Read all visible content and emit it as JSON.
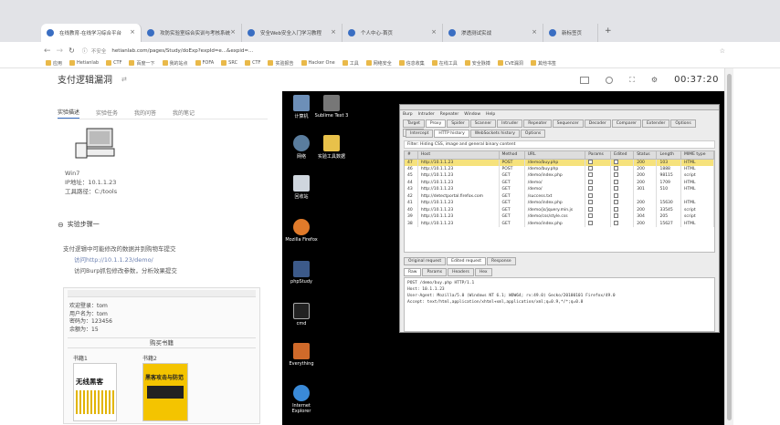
{
  "browser": {
    "tabs": [
      {
        "title": "在线教育-在线学习综合平台"
      },
      {
        "title": "攻防实验室综合实训与考核系统"
      },
      {
        "title": "安全Web安全入门学习教程"
      },
      {
        "title": "个人中心-首页"
      },
      {
        "title": "渗透测试实战"
      },
      {
        "title": "新标签页"
      }
    ],
    "security_label": "不安全",
    "url": "hetianlab.com/pages/Study/doExp?expId=e...&expid=...",
    "bookmarks": [
      "应用",
      "Hetianlab",
      "CTF",
      "百度一下",
      "我的站点",
      "FOFA",
      "SRC",
      "CTF",
      "实验报告",
      "Hacker One",
      "工具",
      "网络安全",
      "信息收集",
      "在线工具",
      "安全脉搏",
      "CVE漏洞",
      "其他书签"
    ]
  },
  "lab": {
    "title": "支付逻辑漏洞",
    "tabs": [
      "实验描述",
      "实验任务",
      "我的问答",
      "我的笔记"
    ],
    "machine": {
      "name": "Win7",
      "ip": "IP地址：10.1.1.23",
      "tools": "工具路径：C:/tools"
    },
    "step_title": "实验步骤一",
    "step_desc": "支付逻辑中可能修改的数据并到购物车提交",
    "step_url": "访问http://10.1.1.23/demo/",
    "step_hint": "访问Burp抓包修改参数，分析效果提交",
    "account": {
      "label": "欢迎登录：tom",
      "user": "用户名为：tom",
      "pwd": "密码为：123456",
      "balance": "余额为：15"
    },
    "buy_header": "购买书籍",
    "books": [
      {
        "label": "书籍1",
        "cover_text": "无线黑客"
      },
      {
        "label": "书籍2",
        "cover_text": "黑客攻击与防范"
      }
    ]
  },
  "toolbar": {
    "time": "00:37:20"
  },
  "desktop": {
    "icons": [
      {
        "label": "计算机"
      },
      {
        "label": "Sublime Text 3"
      },
      {
        "label": "网络"
      },
      {
        "label": "实验工具数据"
      },
      {
        "label": "回收站"
      },
      {
        "label": "Mozilla Firefox"
      },
      {
        "label": "phpStudy"
      },
      {
        "label": "cmd"
      },
      {
        "label": "Everything"
      },
      {
        "label": "Internet Explorer"
      }
    ]
  },
  "burp": {
    "menu": [
      "Burp",
      "Intruder",
      "Repeater",
      "Window",
      "Help"
    ],
    "tabs": [
      "Target",
      "Proxy",
      "Spider",
      "Scanner",
      "Intruder",
      "Repeater",
      "Sequencer",
      "Decoder",
      "Comparer",
      "Extender",
      "Options",
      "Alerts"
    ],
    "subtabs": [
      "Intercept",
      "HTTP history",
      "WebSockets history",
      "Options"
    ],
    "filter": "Filter: Hiding CSS, image and general binary content",
    "columns": [
      "#",
      "Host",
      "Method",
      "URL",
      "Params",
      "Edited",
      "Status",
      "Length",
      "MIME type"
    ],
    "rows": [
      {
        "n": "47",
        "host": "http://10.1.1.23",
        "method": "POST",
        "url": "/demo/buy.php",
        "status": "200",
        "length": "103",
        "mime": "HTML"
      },
      {
        "n": "46",
        "host": "http://10.1.1.23",
        "method": "POST",
        "url": "/demo/buy.php",
        "status": "200",
        "length": "1888",
        "mime": "HTML"
      },
      {
        "n": "45",
        "host": "http://10.1.1.23",
        "method": "GET",
        "url": "/demo/index.php",
        "status": "200",
        "length": "98115",
        "mime": "script"
      },
      {
        "n": "44",
        "host": "http://10.1.1.23",
        "method": "GET",
        "url": "/demo/",
        "status": "200",
        "length": "1709",
        "mime": "HTML"
      },
      {
        "n": "43",
        "host": "http://10.1.1.23",
        "method": "GET",
        "url": "/demo/",
        "status": "301",
        "length": "510",
        "mime": "HTML"
      },
      {
        "n": "42",
        "host": "http://detectportal.firefox.com",
        "method": "GET",
        "url": "/success.txt",
        "status": "",
        "length": "",
        "mime": ""
      },
      {
        "n": "41",
        "host": "http://10.1.1.23",
        "method": "GET",
        "url": "/demo/index.php",
        "status": "200",
        "length": "15630",
        "mime": "HTML"
      },
      {
        "n": "40",
        "host": "http://10.1.1.23",
        "method": "GET",
        "url": "/demo/js/jquery.min.js",
        "status": "200",
        "length": "33545",
        "mime": "script"
      },
      {
        "n": "39",
        "host": "http://10.1.1.23",
        "method": "GET",
        "url": "/demo/css/style.css",
        "status": "304",
        "length": "205",
        "mime": "script"
      },
      {
        "n": "38",
        "host": "http://10.1.1.23",
        "method": "GET",
        "url": "/demo/index.php",
        "status": "200",
        "length": "15627",
        "mime": "HTML"
      }
    ],
    "detail_tabs": [
      "Original request",
      "Edited request",
      "Response"
    ],
    "view_tabs": [
      "Raw",
      "Params",
      "Headers",
      "Hex"
    ],
    "request_lines": [
      "POST /demo/buy.php HTTP/1.1",
      "Host: 10.1.1.23",
      "User-Agent: Mozilla/5.0 (Windows NT 6.1; WOW64; rv:49.0) Gecko/20100101 Firefox/49.0",
      "Accept: text/html,application/xhtml+xml,application/xml;q=0.9,*/*;q=0.8"
    ]
  },
  "colors": {
    "accent": "#3a6ec2",
    "selection": "#f6e27c",
    "desktop_bg": "#000000"
  }
}
